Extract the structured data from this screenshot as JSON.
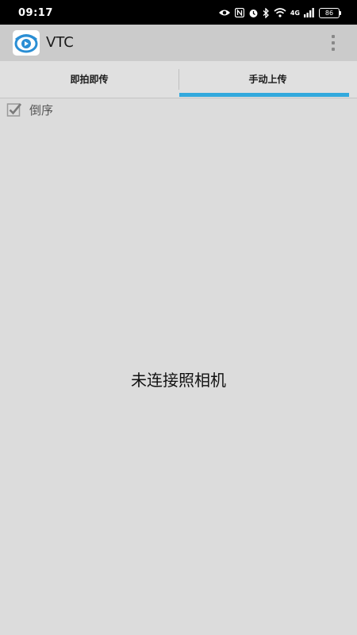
{
  "status_bar": {
    "time": "09:17",
    "network_label": "4G",
    "battery_level": "86"
  },
  "app_bar": {
    "title": "VTC",
    "accent_color": "#33a9dd"
  },
  "tabs": [
    {
      "label": "即拍即传",
      "selected": false
    },
    {
      "label": "手动上传",
      "selected": true
    }
  ],
  "options": {
    "reverse_order_label": "倒序",
    "reverse_order_checked": true
  },
  "main": {
    "empty_message": "未连接照相机"
  }
}
